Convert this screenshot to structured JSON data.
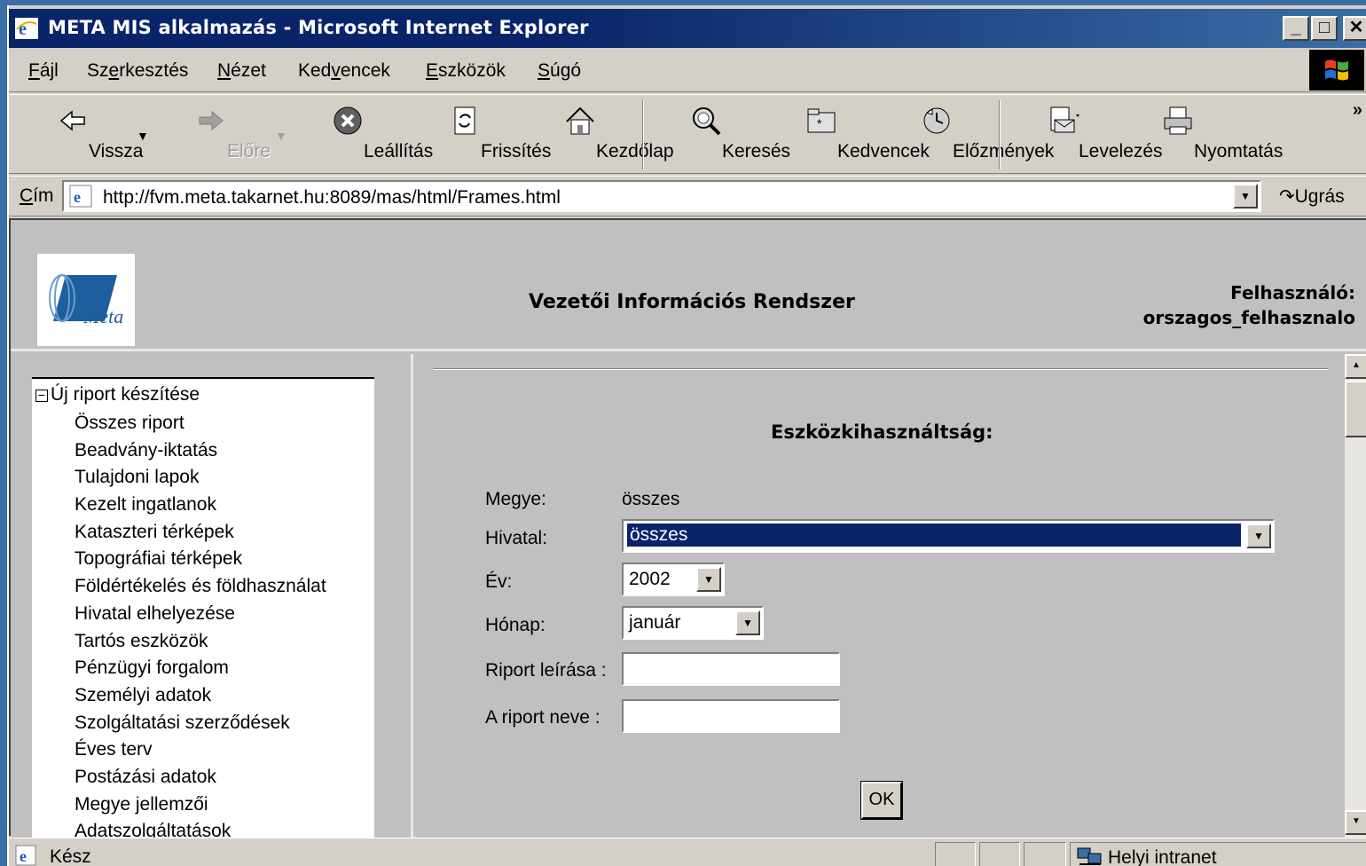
{
  "window": {
    "title": "META MIS alkalmazás - Microsoft Internet Explorer",
    "controls": {
      "minimize": "_",
      "maximize": "□",
      "close": "✕"
    }
  },
  "menubar": {
    "items": [
      {
        "first": "F",
        "rest": "ájl"
      },
      {
        "pre": "Sz",
        "u": "e",
        "post": "rkesztés"
      },
      {
        "first": "N",
        "rest": "ézet"
      },
      {
        "pre": "Ked",
        "u": "v",
        "post": "encek"
      },
      {
        "first": "E",
        "rest": "szközök"
      },
      {
        "first": "S",
        "rest": "úgó"
      }
    ]
  },
  "toolbar": {
    "back": "Vissza",
    "forward": "Előre",
    "stop": "Leállítás",
    "refresh": "Frissítés",
    "home": "Kezdőlap",
    "search": "Keresés",
    "favorites": "Kedvencek",
    "history": "Előzmények",
    "mail": "Levelezés",
    "print": "Nyomtatás",
    "more": "»"
  },
  "addressbar": {
    "label_u": "C",
    "label_rest": "ím",
    "url": "http://fvm.meta.takarnet.hu:8089/mas/html/Frames.html",
    "go": "Ugrás"
  },
  "header": {
    "logo_text": "Meta",
    "title": "Vezetői Információs Rendszer",
    "user_label": "Felhasználó:",
    "user_name": "orszagos_felhasznalo"
  },
  "tree": {
    "root_toggle": "−",
    "root": "Új riport készítése",
    "items": [
      "Összes riport",
      "Beadvány-iktatás",
      "Tulajdoni lapok",
      "Kezelt ingatlanok",
      "Kataszteri térképek",
      "Topográfiai térképek",
      "Földértékelés és földhasználat",
      "Hivatal elhelyezése",
      "Tartós eszközök",
      "Pénzügyi forgalom",
      "Személyi adatok",
      "Szolgáltatási szerződések",
      "Éves terv",
      "Postázási adatok",
      "Megye jellemzői",
      "Adatszolgáltatások"
    ]
  },
  "form": {
    "title": "Eszközkihasználtság:",
    "megye_label": "Megye:",
    "megye_value": "összes",
    "hivatal_label": "Hivatal:",
    "hivatal_value": "összes",
    "ev_label": "Év:",
    "ev_value": "2002",
    "honap_label": "Hónap:",
    "honap_value": "január",
    "leiras_label": "Riport leírása :",
    "leiras_value": "",
    "nev_label": "A riport neve :",
    "nev_value": "",
    "ok": "OK"
  },
  "statusbar": {
    "text": "Kész",
    "zone": "Helyi intranet"
  }
}
